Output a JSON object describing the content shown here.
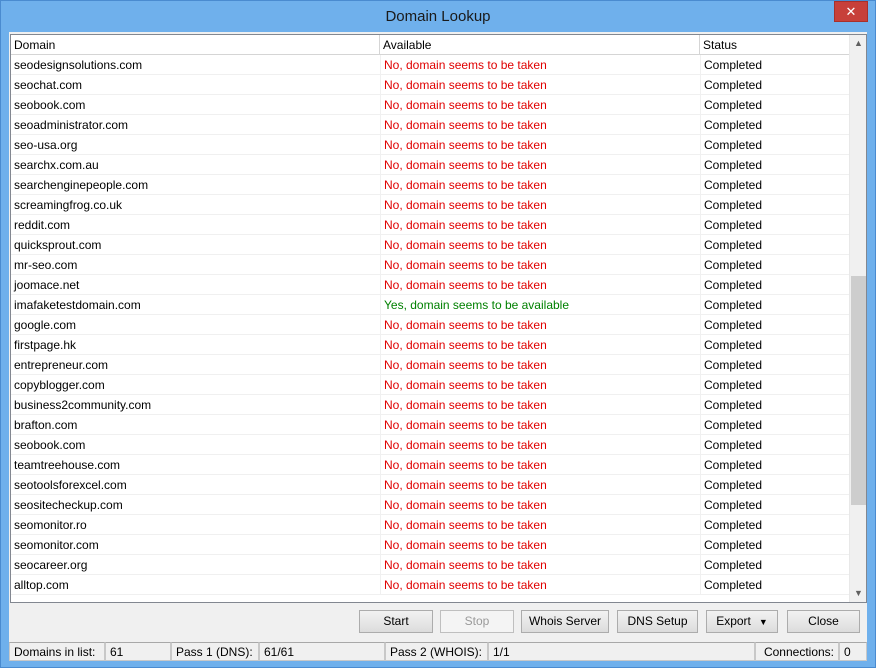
{
  "window": {
    "title": "Domain Lookup",
    "close_glyph": "✕"
  },
  "columns": {
    "domain": "Domain",
    "available": "Available",
    "status": "Status"
  },
  "rows": [
    {
      "domain": "seodesignsolutions.com",
      "available": "No, domain seems to be taken",
      "status": "Completed",
      "ok": false
    },
    {
      "domain": "seochat.com",
      "available": "No, domain seems to be taken",
      "status": "Completed",
      "ok": false
    },
    {
      "domain": "seobook.com",
      "available": "No, domain seems to be taken",
      "status": "Completed",
      "ok": false
    },
    {
      "domain": "seoadministrator.com",
      "available": "No, domain seems to be taken",
      "status": "Completed",
      "ok": false
    },
    {
      "domain": "seo-usa.org",
      "available": "No, domain seems to be taken",
      "status": "Completed",
      "ok": false
    },
    {
      "domain": "searchx.com.au",
      "available": "No, domain seems to be taken",
      "status": "Completed",
      "ok": false
    },
    {
      "domain": "searchenginepeople.com",
      "available": "No, domain seems to be taken",
      "status": "Completed",
      "ok": false
    },
    {
      "domain": "screamingfrog.co.uk",
      "available": "No, domain seems to be taken",
      "status": "Completed",
      "ok": false
    },
    {
      "domain": "reddit.com",
      "available": "No, domain seems to be taken",
      "status": "Completed",
      "ok": false
    },
    {
      "domain": "quicksprout.com",
      "available": "No, domain seems to be taken",
      "status": "Completed",
      "ok": false
    },
    {
      "domain": "mr-seo.com",
      "available": "No, domain seems to be taken",
      "status": "Completed",
      "ok": false
    },
    {
      "domain": "joomace.net",
      "available": "No, domain seems to be taken",
      "status": "Completed",
      "ok": false
    },
    {
      "domain": "imafaketestdomain.com",
      "available": "Yes, domain seems to be available",
      "status": "Completed",
      "ok": true
    },
    {
      "domain": "google.com",
      "available": "No, domain seems to be taken",
      "status": "Completed",
      "ok": false
    },
    {
      "domain": "firstpage.hk",
      "available": "No, domain seems to be taken",
      "status": "Completed",
      "ok": false
    },
    {
      "domain": "entrepreneur.com",
      "available": "No, domain seems to be taken",
      "status": "Completed",
      "ok": false
    },
    {
      "domain": "copyblogger.com",
      "available": "No, domain seems to be taken",
      "status": "Completed",
      "ok": false
    },
    {
      "domain": "business2community.com",
      "available": "No, domain seems to be taken",
      "status": "Completed",
      "ok": false
    },
    {
      "domain": "brafton.com",
      "available": "No, domain seems to be taken",
      "status": "Completed",
      "ok": false
    },
    {
      "domain": "seobook.com",
      "available": "No, domain seems to be taken",
      "status": "Completed",
      "ok": false
    },
    {
      "domain": "teamtreehouse.com",
      "available": "No, domain seems to be taken",
      "status": "Completed",
      "ok": false
    },
    {
      "domain": "seotoolsforexcel.com",
      "available": "No, domain seems to be taken",
      "status": "Completed",
      "ok": false
    },
    {
      "domain": "seositecheckup.com",
      "available": "No, domain seems to be taken",
      "status": "Completed",
      "ok": false
    },
    {
      "domain": "seomonitor.ro",
      "available": "No, domain seems to be taken",
      "status": "Completed",
      "ok": false
    },
    {
      "domain": "seomonitor.com",
      "available": "No, domain seems to be taken",
      "status": "Completed",
      "ok": false
    },
    {
      "domain": "seocareer.org",
      "available": "No, domain seems to be taken",
      "status": "Completed",
      "ok": false
    },
    {
      "domain": "alltop.com",
      "available": "No, domain seems to be taken",
      "status": "Completed",
      "ok": false
    }
  ],
  "colors": {
    "taken": "#e00000",
    "available": "#008000"
  },
  "buttons": {
    "start": "Start",
    "stop": "Stop",
    "whois_server": "Whois Server",
    "dns_setup": "DNS Setup",
    "export": "Export",
    "close": "Close"
  },
  "statusbar": {
    "domains_label": "Domains in list:",
    "domains_value": "61",
    "pass1_label": "Pass 1 (DNS):",
    "pass1_value": "61/61",
    "pass2_label": "Pass 2 (WHOIS):",
    "pass2_value": "1/1",
    "connections_label": "Connections:",
    "connections_value": "0"
  }
}
